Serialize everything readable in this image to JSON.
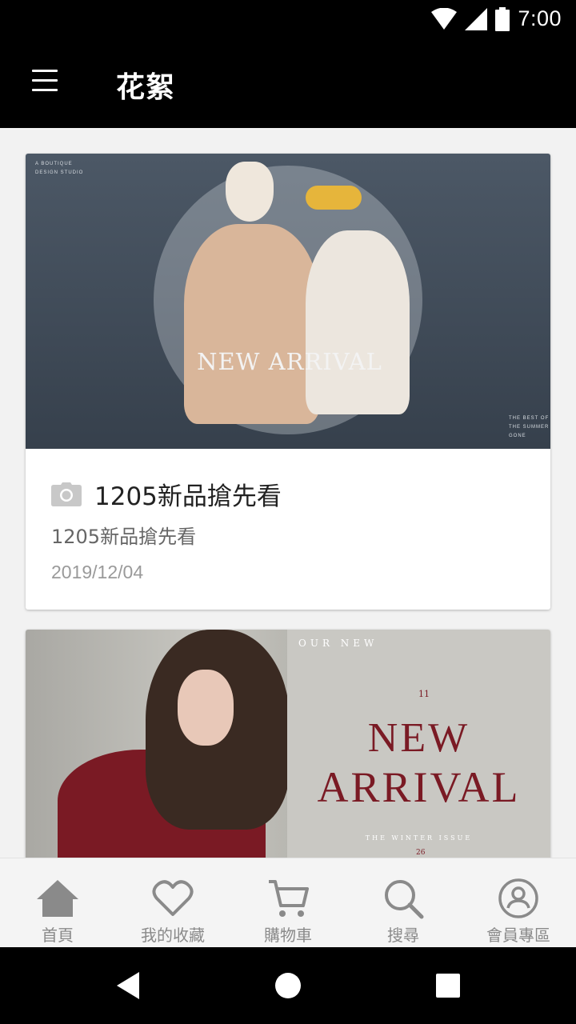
{
  "status_bar": {
    "time": "7:00",
    "icons": [
      "wifi-icon",
      "signal-icon",
      "battery-icon"
    ]
  },
  "app_bar": {
    "title": "花絮",
    "menu_icon": "hamburger-menu-icon"
  },
  "posts": [
    {
      "image_text": {
        "headline": "NEW ARRIVAL",
        "corner_tl_1": "A BOUTIQUE",
        "corner_tl_2": "DESIGN STUDIO",
        "corner_br_1": "THE BEST OF",
        "corner_br_2": "THE SUMMER",
        "corner_br_3": "GONE"
      },
      "icon": "camera-icon",
      "title": "1205新品搶先看",
      "subtitle": "1205新品搶先看",
      "date": "2019/12/04"
    },
    {
      "image_text": {
        "our_new": "OUR NEW",
        "issue_number": "11",
        "line1": "NEW",
        "line2": "ARRIVAL",
        "issue": "THE WINTER ISSUE",
        "page_number": "26"
      }
    }
  ],
  "bottom_nav": [
    {
      "label": "首頁",
      "icon": "home-icon"
    },
    {
      "label": "我的收藏",
      "icon": "heart-icon"
    },
    {
      "label": "購物車",
      "icon": "cart-icon"
    },
    {
      "label": "搜尋",
      "icon": "search-icon"
    },
    {
      "label": "會員專區",
      "icon": "account-icon"
    }
  ],
  "system_nav": [
    "back-icon",
    "home-circle-icon",
    "recents-icon"
  ],
  "colors": {
    "app_bar": "#000000",
    "background": "#f2f2f2",
    "nav_icon": "#8a8a8a",
    "accent_burgundy": "#7a1a24"
  }
}
